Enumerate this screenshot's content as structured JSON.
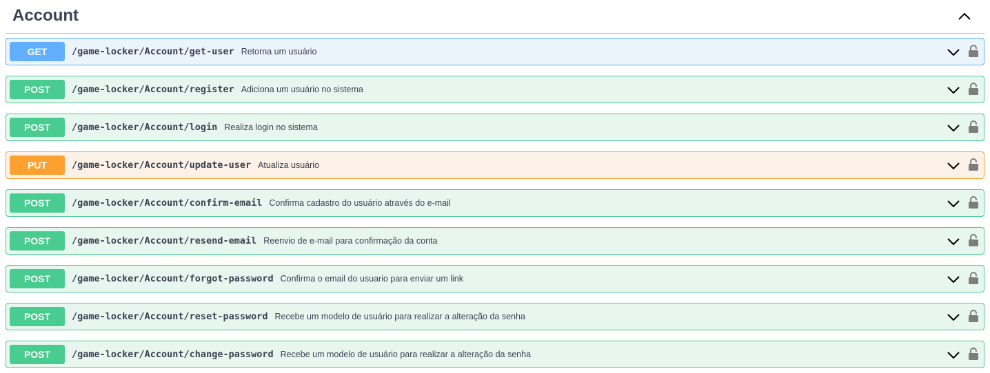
{
  "section": {
    "title": "Account",
    "icon": "chevron-up-icon"
  },
  "colors": {
    "get": "#61affe",
    "post": "#49cc90",
    "put": "#fca130",
    "text": "#3b4151",
    "lock": "#7d7d7d"
  },
  "operations": [
    {
      "method": "GET",
      "path": "/game-locker/Account/get-user",
      "summary": "Retorna um usuário"
    },
    {
      "method": "POST",
      "path": "/game-locker/Account/register",
      "summary": "Adiciona um usuário no sistema"
    },
    {
      "method": "POST",
      "path": "/game-locker/Account/login",
      "summary": "Realiza login no sistema"
    },
    {
      "method": "PUT",
      "path": "/game-locker/Account/update-user",
      "summary": "Atualiza usuário"
    },
    {
      "method": "POST",
      "path": "/game-locker/Account/confirm-email",
      "summary": "Confirma cadastro do usuário através do e-mail"
    },
    {
      "method": "POST",
      "path": "/game-locker/Account/resend-email",
      "summary": "Reenvio de e-mail para confirmação da conta"
    },
    {
      "method": "POST",
      "path": "/game-locker/Account/forgot-password",
      "summary": "Confirma o email do usuario para enviar um link"
    },
    {
      "method": "POST",
      "path": "/game-locker/Account/reset-password",
      "summary": "Recebe um modelo de usuário para realizar a alteração da senha"
    },
    {
      "method": "POST",
      "path": "/game-locker/Account/change-password",
      "summary": "Recebe um modelo de usuário para realizar a alteração da senha"
    }
  ]
}
